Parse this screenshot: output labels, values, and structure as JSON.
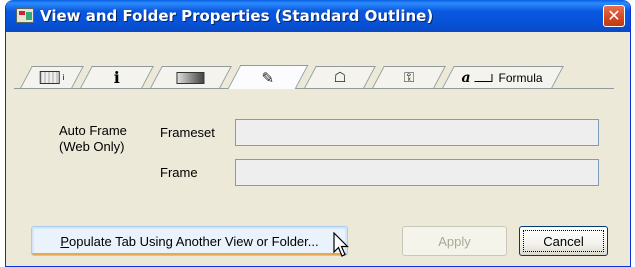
{
  "window": {
    "title": "View and Folder Properties (Standard Outline)",
    "close_symbol": "✕",
    "icon": "properties-box-icon"
  },
  "tabs": [
    {
      "name": "tab-basics",
      "icon": "grid-info-icon",
      "label": ""
    },
    {
      "name": "tab-info",
      "icon": "info-icon",
      "label": ""
    },
    {
      "name": "tab-style",
      "icon": "gradient-bar-icon",
      "label": ""
    },
    {
      "name": "tab-advanced",
      "icon": "brush-icon",
      "label": "",
      "active": true
    },
    {
      "name": "tab-tree",
      "icon": "tree-icon",
      "label": ""
    },
    {
      "name": "tab-security",
      "icon": "key-icon",
      "label": ""
    },
    {
      "name": "tab-formula",
      "icon": "formula-icon",
      "label": "Formula"
    }
  ],
  "auto_frame": {
    "section_label_line1": "Auto Frame",
    "section_label_line2": "(Web Only)",
    "frameset_label": "Frameset",
    "frameset_value": "",
    "frame_label": "Frame",
    "frame_value": ""
  },
  "buttons": {
    "populate_mnemonic": "P",
    "populate_rest": "opulate Tab Using Another View or Folder...",
    "apply": "Apply",
    "cancel": "Cancel"
  },
  "colors": {
    "titlebar": "#0653d8",
    "window_bg": "#ece9d8",
    "close": "#d4471f"
  }
}
